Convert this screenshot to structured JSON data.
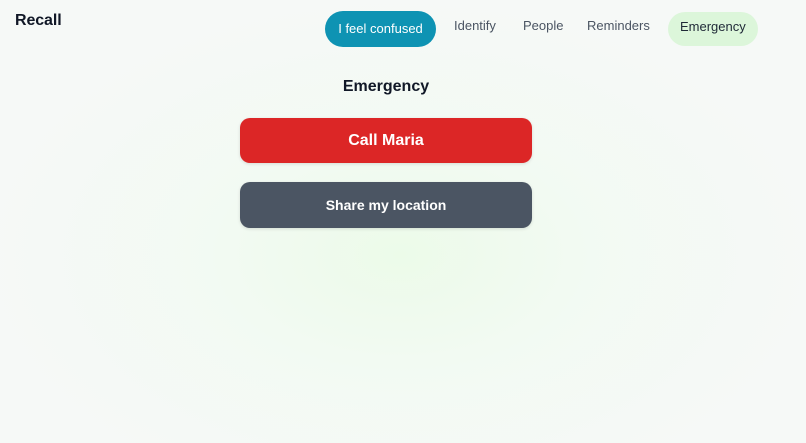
{
  "app": {
    "title": "Recall"
  },
  "nav": {
    "confused_label": "I feel confused",
    "items": [
      {
        "label": "Identify"
      },
      {
        "label": "People"
      },
      {
        "label": "Reminders"
      },
      {
        "label": "Emergency",
        "active": true
      }
    ]
  },
  "emergency": {
    "title": "Emergency",
    "call_label": "Call Maria",
    "share_label": "Share my location"
  },
  "colors": {
    "accent": "#0e93b3",
    "active_tab_bg": "#dcf6da",
    "call_button": "#dc2626",
    "share_button": "#4b5563"
  }
}
